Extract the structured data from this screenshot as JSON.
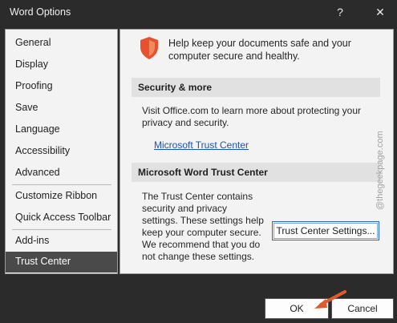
{
  "window": {
    "title": "Word Options",
    "help": "?",
    "close": "✕"
  },
  "sidebar": {
    "items": [
      {
        "label": "General"
      },
      {
        "label": "Display"
      },
      {
        "label": "Proofing"
      },
      {
        "label": "Save"
      },
      {
        "label": "Language"
      },
      {
        "label": "Accessibility"
      },
      {
        "label": "Advanced"
      },
      {
        "label": "Customize Ribbon"
      },
      {
        "label": "Quick Access Toolbar"
      },
      {
        "label": "Add-ins"
      },
      {
        "label": "Trust Center"
      }
    ],
    "selected": "Trust Center"
  },
  "main": {
    "intro_line1": "Help keep your documents safe and your",
    "intro_line2": "computer secure and healthy.",
    "security": {
      "heading": "Security & more",
      "text_line1": "Visit Office.com to learn more about protecting your",
      "text_line2": "privacy and security.",
      "link": "Microsoft Trust Center"
    },
    "trust_center": {
      "heading": "Microsoft Word Trust Center",
      "lines": [
        "The Trust Center contains",
        "security and privacy",
        "settings. These settings help",
        "keep your computer secure.",
        "We recommend that you do",
        "not change these settings."
      ],
      "button": "Trust Center Settings..."
    }
  },
  "watermark": "@thegeekpage.com",
  "footer": {
    "ok": "OK",
    "cancel": "Cancel"
  },
  "colors": {
    "selected_bg": "#4a4a4a",
    "link": "#1a52b5",
    "shield": "#e8512f",
    "arrow": "#e05a2b"
  }
}
